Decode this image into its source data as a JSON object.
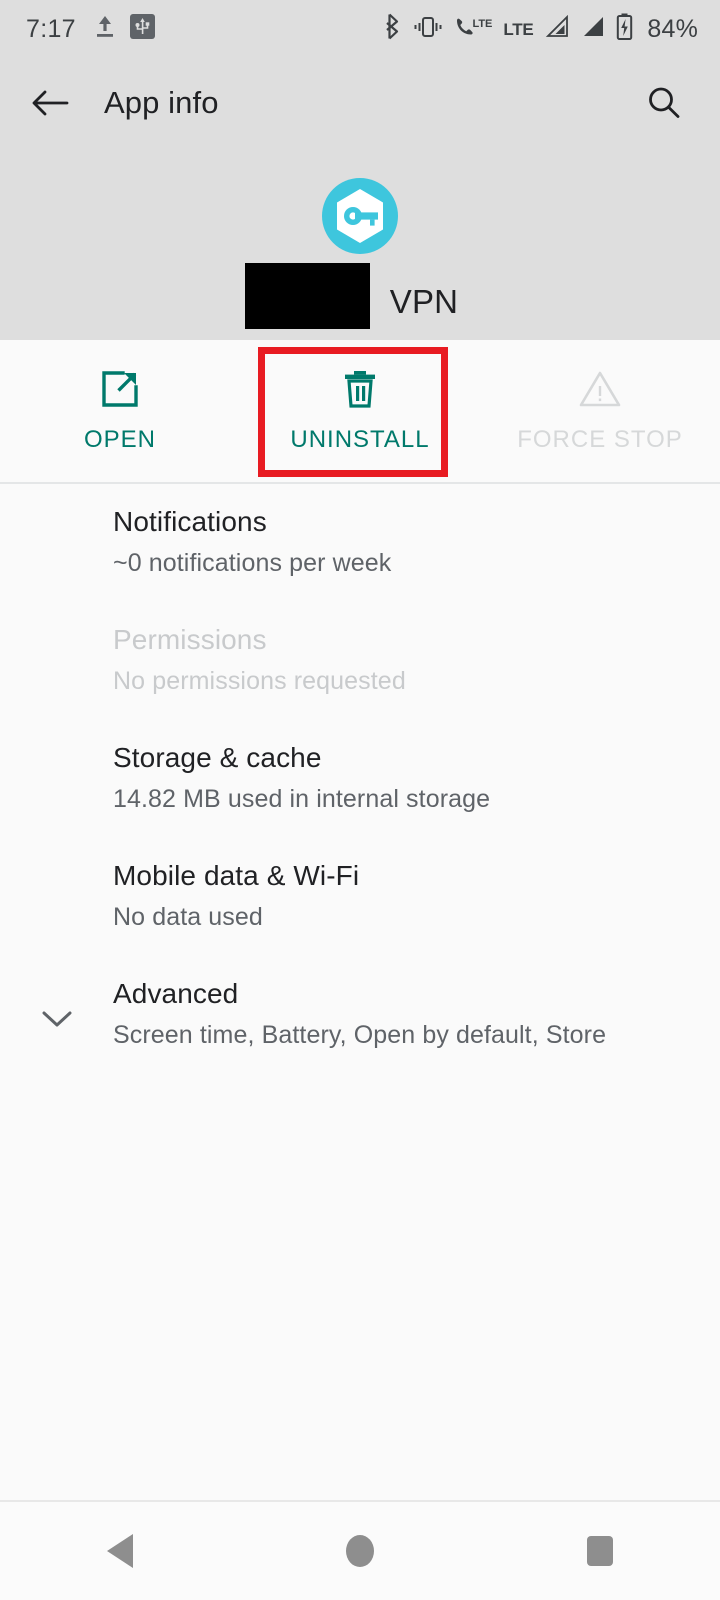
{
  "status_bar": {
    "time": "7:17",
    "battery_percent": "84%",
    "lte_label": "LTE",
    "volte_label": "LTE",
    "icons": [
      "upload-icon",
      "usb-icon",
      "bluetooth-icon",
      "vibrate-icon",
      "volte-icon",
      "lte-icon",
      "signal-bar-icon",
      "signal-bar-icon",
      "battery-charging-icon"
    ]
  },
  "app_bar": {
    "back_icon": "arrow-back-icon",
    "title": "App info",
    "search_icon": "search-icon"
  },
  "app_header": {
    "icon_name": "vpn-key-app-icon",
    "app_name": "VPN",
    "redacted": true,
    "icon_colors": {
      "circle": "#3ec6dd",
      "hexagon": "#ffffff",
      "key": "#3ec6dd"
    }
  },
  "actions": {
    "accent_color": "#00796b",
    "disabled_color": "#d6d8d9",
    "highlight_color": "#e81b22",
    "items": [
      {
        "label": "OPEN",
        "icon": "open-in-new-icon",
        "enabled": true,
        "highlighted": false
      },
      {
        "label": "UNINSTALL",
        "icon": "trash-icon",
        "enabled": true,
        "highlighted": true
      },
      {
        "label": "FORCE STOP",
        "icon": "warning-triangle-icon",
        "enabled": false,
        "highlighted": false
      }
    ]
  },
  "settings": {
    "items": [
      {
        "title": "Notifications",
        "subtitle": "~0 notifications per week",
        "enabled": true,
        "leading_icon": ""
      },
      {
        "title": "Permissions",
        "subtitle": "No permissions requested",
        "enabled": false,
        "leading_icon": ""
      },
      {
        "title": "Storage & cache",
        "subtitle": "14.82 MB used in internal storage",
        "enabled": true,
        "leading_icon": ""
      },
      {
        "title": "Mobile data & Wi-Fi",
        "subtitle": "No data used",
        "enabled": true,
        "leading_icon": ""
      },
      {
        "title": "Advanced",
        "subtitle": "Screen time, Battery, Open by default, Store",
        "enabled": true,
        "leading_icon": "chevron-down-icon"
      }
    ]
  },
  "nav_bar": {
    "back_label": "Back",
    "home_label": "Home",
    "recents_label": "Recents"
  }
}
